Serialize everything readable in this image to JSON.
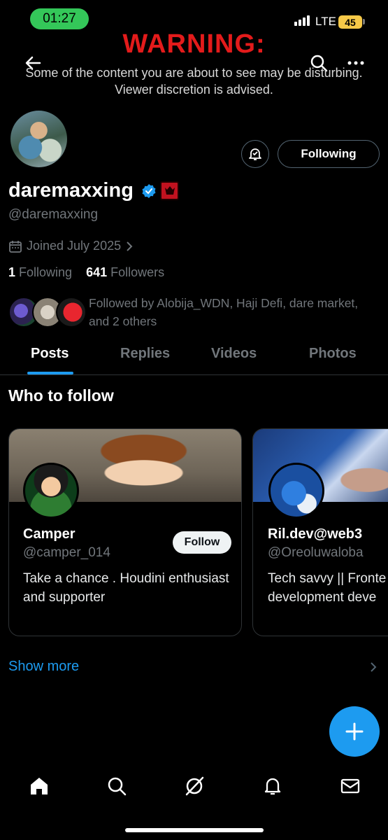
{
  "status_bar": {
    "time": "01:27",
    "network": "LTE",
    "battery": "45"
  },
  "warning": {
    "title": "WARNING:",
    "line1": "Some of the content you are about to see may be disturbing.",
    "line2": "Viewer discretion is advised."
  },
  "profile": {
    "display_name": "daremaxxing",
    "handle": "@daremaxxing",
    "joined": "Joined July 2025",
    "following_count": "1",
    "following_label": "Following",
    "followers_count": "641",
    "followers_label": "Followers",
    "followed_by": "Followed by Alobija_WDN, Haji Defi, dare market, and 2 others",
    "follow_state_label": "Following"
  },
  "tabs": [
    {
      "label": "Posts",
      "active": true
    },
    {
      "label": "Replies",
      "active": false
    },
    {
      "label": "Videos",
      "active": false
    },
    {
      "label": "Photos",
      "active": false
    }
  ],
  "who_to_follow": {
    "title": "Who to follow",
    "cards": [
      {
        "name": "Camper",
        "handle": "@camper_014",
        "bio": "Take a chance . Houdini enthusiast and supporter",
        "button": "Follow"
      },
      {
        "name": "Ril.dev@web3",
        "handle": "@Oreoluwaloba",
        "bio_line1": "Tech savvy || Fronte",
        "bio_line2": "development deve"
      }
    ],
    "show_more": "Show more"
  },
  "nav": [
    "home-icon",
    "search-icon",
    "grok-icon",
    "notifications-icon",
    "messages-icon"
  ],
  "colors": {
    "accent": "#1d9bf0",
    "warning": "#e31b1b",
    "muted": "#71767b",
    "background": "#000000"
  }
}
